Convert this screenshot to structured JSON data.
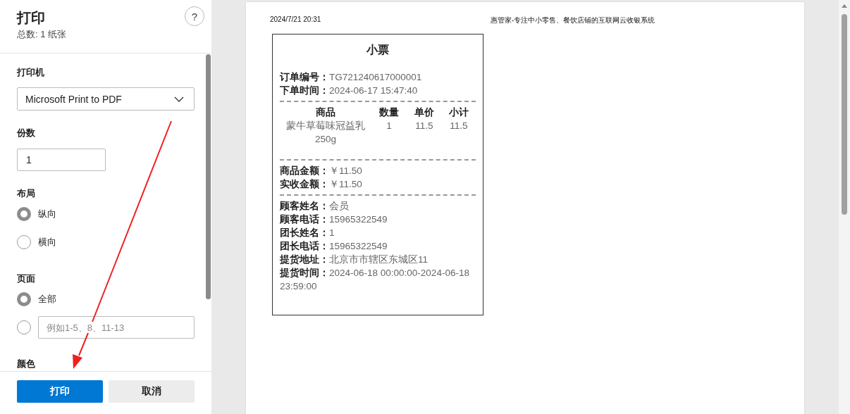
{
  "panel": {
    "title": "打印",
    "subtitle": "总数: 1 纸张",
    "help": "?",
    "printer": {
      "label": "打印机",
      "value": "Microsoft Print to PDF"
    },
    "copies": {
      "label": "份数",
      "value": "1"
    },
    "layout": {
      "label": "布局",
      "options": [
        {
          "label": "纵向",
          "selected": true
        },
        {
          "label": "横向",
          "selected": false
        }
      ]
    },
    "pages": {
      "label": "页面",
      "options": [
        {
          "kind": "radio",
          "label": "全部",
          "selected": true
        },
        {
          "kind": "range",
          "placeholder": "例如1-5、8、11-13",
          "selected": false
        }
      ]
    },
    "color": {
      "label": "颜色"
    },
    "buttons": [
      {
        "label": "打印",
        "kind": "primary"
      },
      {
        "label": "取消",
        "kind": "secondary"
      }
    ]
  },
  "preview": {
    "header_left": "2024/7/21 20:31",
    "header_right": "惠管家-专注中小零售、餐饮店铺的互联网云收银系统",
    "receipt": {
      "title": "小票",
      "order_fields": [
        {
          "label": "订单编号：",
          "value": "TG721240617000001"
        },
        {
          "label": "下单时间：",
          "value": "2024-06-17 15:47:40"
        }
      ],
      "columns": [
        "商品",
        "数量",
        "单价",
        "小计"
      ],
      "rows": [
        [
          "蒙牛草莓味冠益乳250g",
          "1",
          "11.5",
          "11.5"
        ]
      ],
      "totals": [
        {
          "label": "商品金额：",
          "value": "￥11.50"
        },
        {
          "label": "实收金额：",
          "value": "￥11.50"
        }
      ],
      "customer_fields": [
        {
          "label": "顾客姓名：",
          "value": "会员"
        },
        {
          "label": "顾客电话：",
          "value": "15965322549"
        },
        {
          "label": "团长姓名：",
          "value": "1"
        },
        {
          "label": "团长电话：",
          "value": "15965322549"
        },
        {
          "label": "提货地址：",
          "value": "北京市市辖区东城区11"
        },
        {
          "label": "提货时间：",
          "value": "2024-06-18 00:00:00-2024-06-18 23:59:00"
        }
      ]
    }
  }
}
